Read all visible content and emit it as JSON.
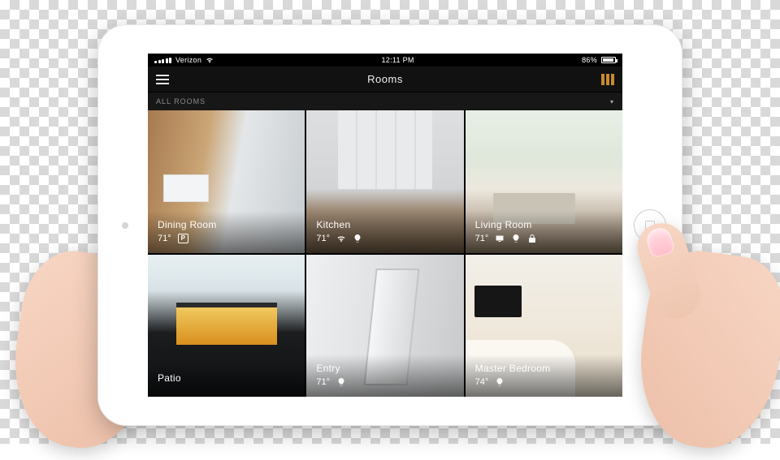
{
  "statusbar": {
    "carrier": "Verizon",
    "time": "12:11 PM",
    "battery_pct": "86%"
  },
  "navbar": {
    "title": "Rooms"
  },
  "filter": {
    "label": "ALL ROOMS"
  },
  "rooms": [
    {
      "name": "Dining Room",
      "temp": "71°",
      "icons": [
        "pandora"
      ]
    },
    {
      "name": "Kitchen",
      "temp": "71°",
      "icons": [
        "wifi",
        "bulb"
      ]
    },
    {
      "name": "Living Room",
      "temp": "71°",
      "icons": [
        "tv",
        "bulb",
        "lock"
      ]
    },
    {
      "name": "Patio",
      "temp": "",
      "icons": []
    },
    {
      "name": "Entry",
      "temp": "71°",
      "icons": [
        "bulb"
      ]
    },
    {
      "name": "Master Bedroom",
      "temp": "74°",
      "icons": [
        "bulb"
      ]
    }
  ]
}
